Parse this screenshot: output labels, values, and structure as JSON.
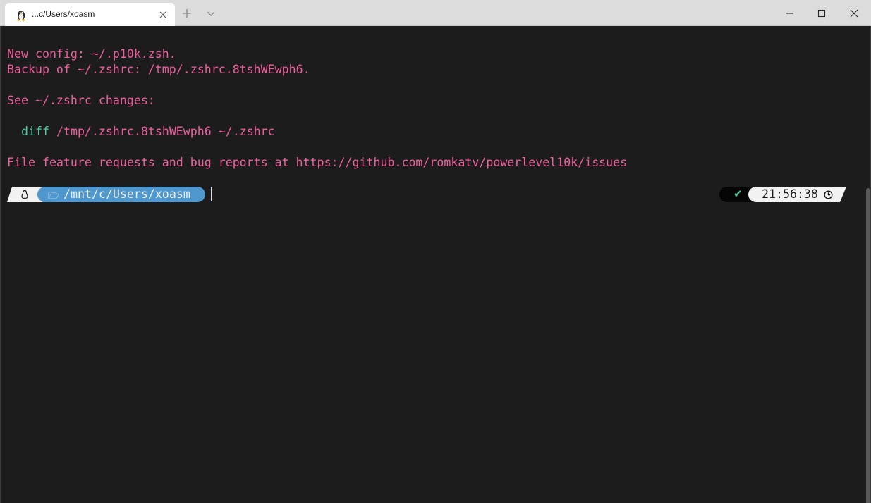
{
  "tab": {
    "icon": "linux-penguin-icon",
    "title": "...c/Users/xoasm",
    "close_icon": "close-icon"
  },
  "titlebar": {
    "new_tab_icon": "plus-icon",
    "dropdown_icon": "chevron-down-icon",
    "window_controls": [
      "minimize-icon",
      "maximize-icon",
      "close-icon"
    ]
  },
  "terminal": {
    "lines": [
      "New config: ~/.p10k.zsh.",
      "Backup of ~/.zshrc: /tmp/.zshrc.8tshWEwph6.",
      "See ~/.zshrc changes:",
      "/tmp/.zshrc.8tshWEwph6 ~/.zshrc",
      "File feature requests and bug reports at https://github.com/romkatv/powerlevel10k/issues"
    ],
    "diff_command": "diff",
    "colors": {
      "background": "#1c1c1c",
      "pink": "#ef5f9f",
      "green": "#4ec9a4",
      "dir_segment": "#4e97cf"
    }
  },
  "prompt": {
    "os_icon": "linux-icon",
    "dir_icon": "folder-open-icon",
    "dir_glyph": "🗁",
    "directory": "/mnt/c/Users/xoasm",
    "status_icon": "checkmark-icon",
    "status_glyph": "✔",
    "time": "21:56:38",
    "time_icon": "clock-icon"
  }
}
